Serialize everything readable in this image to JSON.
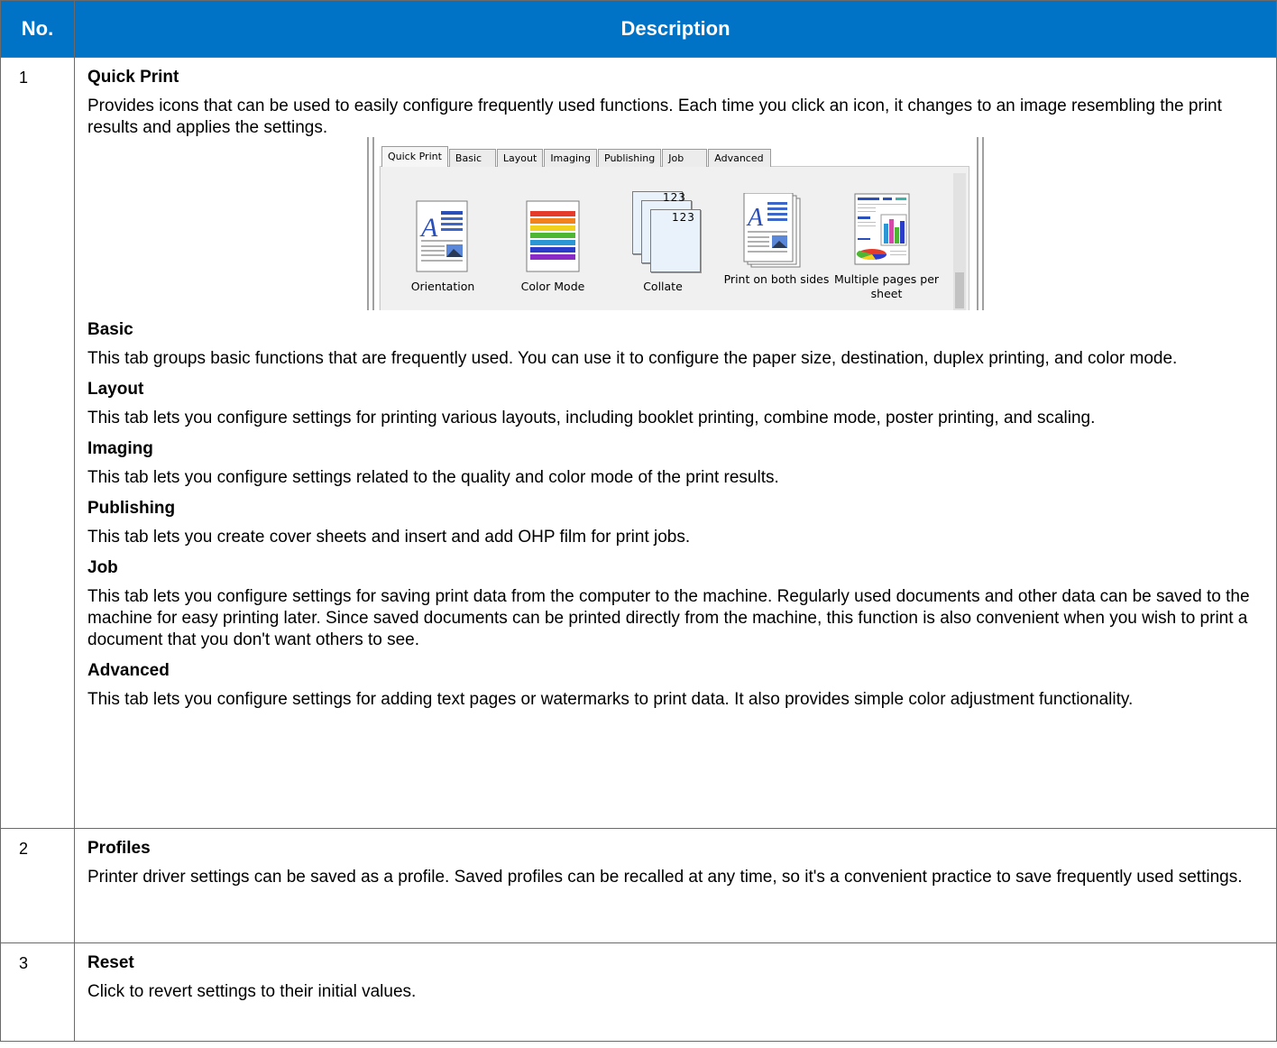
{
  "table": {
    "header_no": "No.",
    "header_description": "Description"
  },
  "rows": [
    {
      "no": "1",
      "sections": [
        {
          "title": "Quick Print",
          "text": "Provides icons that can be used to easily configure frequently used functions. Each time you click an icon, it changes to an image resembling the print results and applies the settings."
        },
        {
          "title": "Basic",
          "text": "This tab groups basic functions that are frequently used. You can use it to configure the paper size, destination, duplex printing, and color mode."
        },
        {
          "title": "Layout",
          "text": "This tab lets you configure settings for printing various layouts, including booklet printing, combine mode, poster printing, and scaling."
        },
        {
          "title": "Imaging",
          "text": "This tab lets you configure settings related to the quality and color mode of the print results."
        },
        {
          "title": "Publishing",
          "text": "This tab lets you create cover sheets and insert and add OHP film for print jobs."
        },
        {
          "title": "Job",
          "text": "This tab lets you configure settings for saving print data from the computer to the machine. Regularly used documents and other data can be saved to the machine for easy printing later. Since saved documents can be printed directly from the machine, this function is also convenient when you wish to print a document that you don't want others to see."
        },
        {
          "title": "Advanced",
          "text": "This tab lets you configure settings for adding text pages or watermarks to print data. It also provides simple color adjustment functionality."
        }
      ]
    },
    {
      "no": "2",
      "title": "Profiles",
      "text": "Printer driver settings can be saved as a profile. Saved profiles can be recalled at any time, so it's a convenient practice to save frequently used settings."
    },
    {
      "no": "3",
      "title": "Reset",
      "text": "Click to revert settings to their initial values."
    }
  ],
  "screenshot": {
    "tabs": [
      "Quick Print",
      "Basic",
      "Layout",
      "Imaging",
      "Publishing",
      "Job",
      "Advanced"
    ],
    "active_tab": "Quick Print",
    "icons": [
      {
        "label": "Orientation",
        "icon": "orientation-icon"
      },
      {
        "label": "Color Mode",
        "icon": "color-mode-icon"
      },
      {
        "label": "Collate",
        "icon": "collate-icon"
      },
      {
        "label": "Print on both sides",
        "icon": "duplex-icon"
      },
      {
        "label": "Multiple pages per sheet",
        "icon": "multiple-pages-icon"
      }
    ],
    "collate_digits": "123"
  },
  "colors": {
    "header_bg": "#0073c6",
    "border": "#6a6a6a"
  }
}
